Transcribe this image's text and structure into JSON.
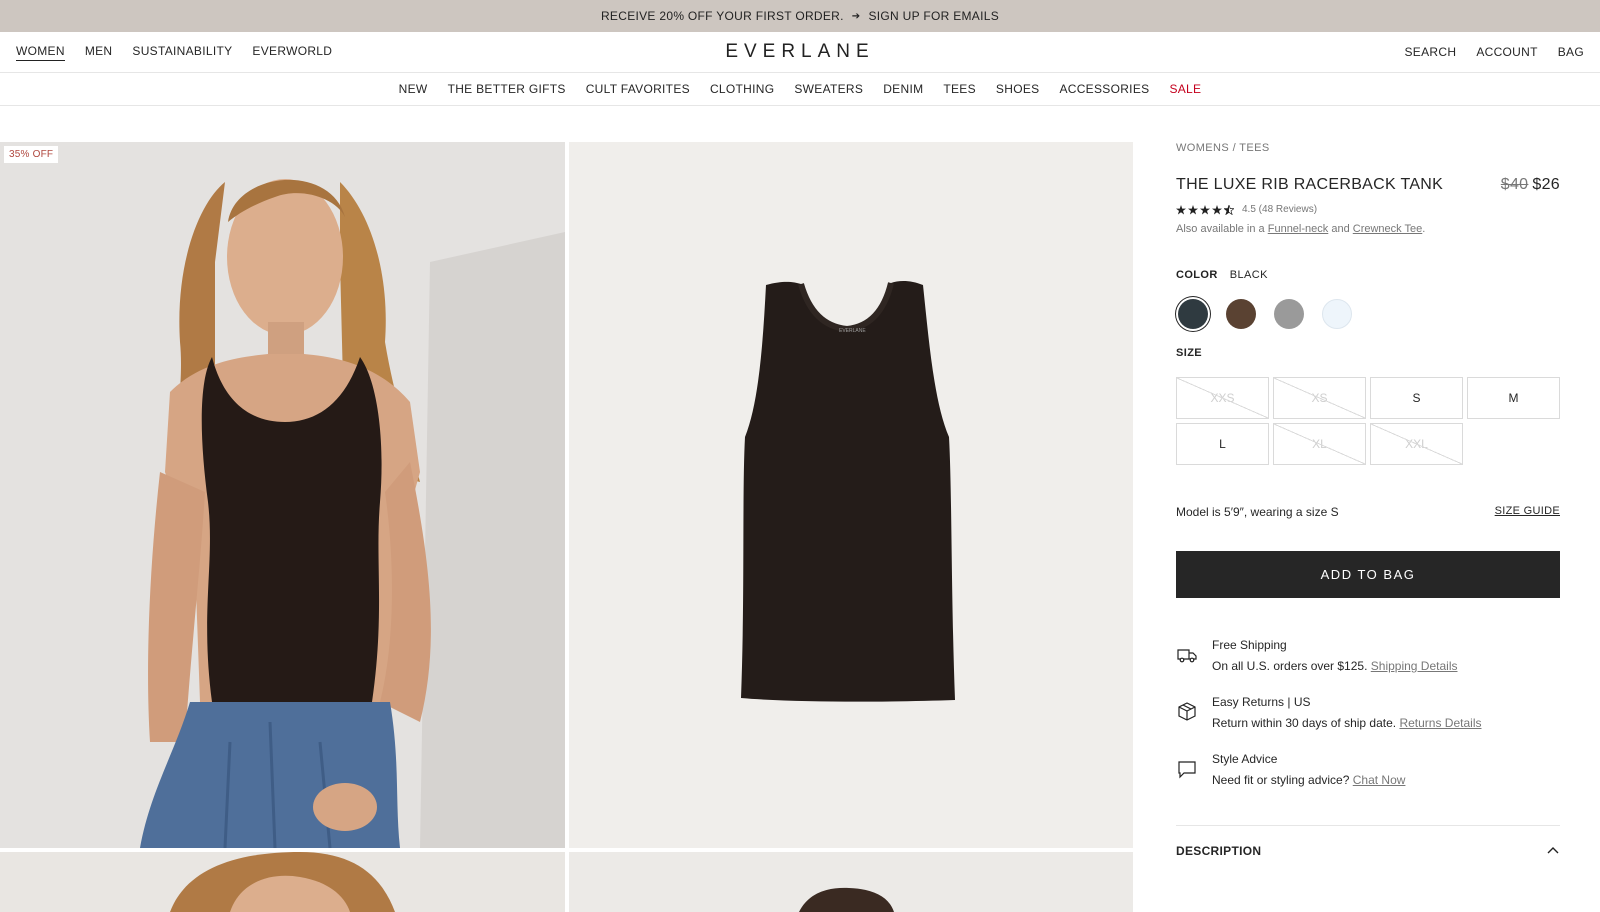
{
  "promo": {
    "text": "RECEIVE 20% OFF YOUR FIRST ORDER.",
    "arrow": "➔",
    "cta": "SIGN UP FOR EMAILS"
  },
  "header": {
    "left": [
      "WOMEN",
      "MEN",
      "SUSTAINABILITY",
      "EVERWORLD"
    ],
    "logo": "EVERLANE",
    "right": [
      "SEARCH",
      "ACCOUNT",
      "BAG"
    ]
  },
  "categories": [
    "NEW",
    "THE BETTER GIFTS",
    "CULT FAVORITES",
    "CLOTHING",
    "SWEATERS",
    "DENIM",
    "TEES",
    "SHOES",
    "ACCESSORIES",
    "SALE"
  ],
  "gallery": {
    "badge": "35% OFF"
  },
  "product": {
    "breadcrumb": "WOMENS / TEES",
    "title": "THE LUXE RIB RACERBACK TANK",
    "price_old": "$40",
    "price_new": "$26",
    "rating_value": 4.5,
    "rating_text": "4.5 (48 Reviews)",
    "also_prefix": "Also available in a",
    "also_link1": "Funnel-neck",
    "also_mid": "and",
    "also_link2": "Crewneck Tee",
    "also_suffix": ".",
    "color_label": "COLOR",
    "color_value": "BLACK",
    "swatches": [
      "#2f3a40",
      "#5a4232",
      "#9a9a9a",
      "#eef5fb"
    ],
    "size_label": "SIZE",
    "sizes": [
      {
        "label": "XXS",
        "available": false
      },
      {
        "label": "XS",
        "available": false
      },
      {
        "label": "S",
        "available": true
      },
      {
        "label": "M",
        "available": true
      },
      {
        "label": "L",
        "available": true
      },
      {
        "label": "XL",
        "available": false
      },
      {
        "label": "XXL",
        "available": false
      }
    ],
    "model_text": "Model is 5′9″, wearing a size S",
    "size_guide": "SIZE GUIDE",
    "add_to_bag": "ADD TO BAG",
    "shipping_title": "Free Shipping",
    "shipping_text": "On all U.S. orders over $125.",
    "shipping_link": "Shipping Details",
    "returns_title": "Easy Returns | US",
    "returns_text": "Return within 30 days of ship date.",
    "returns_link": "Returns Details",
    "style_title": "Style Advice",
    "style_text": "Need fit or styling advice?",
    "style_link": "Chat Now",
    "description_label": "DESCRIPTION"
  }
}
